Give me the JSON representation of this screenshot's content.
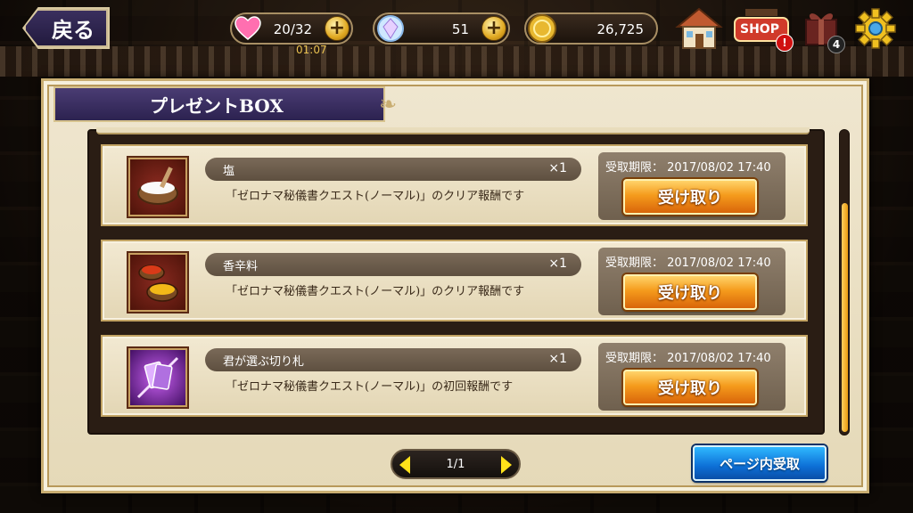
{
  "header": {
    "back_label": "戻る",
    "stamina": {
      "value": "20/32",
      "timer": "01:07",
      "icon": "heart-icon"
    },
    "gems": {
      "value": "51",
      "icon": "crystal-icon"
    },
    "coins": {
      "value": "26,725",
      "icon": "coin-icon"
    },
    "shop_label": "SHOP",
    "shop_badge": "!",
    "gift_badge": "4"
  },
  "panel": {
    "title": "プレゼントBOX"
  },
  "items": [
    {
      "name": "塩",
      "qty": "×1",
      "desc": "「ゼロナマ秘儀書クエスト(ノーマル)」のクリア報酬です",
      "deadline": "受取期限： 2017/08/02 17:40",
      "claim_label": "受け取り",
      "icon": "salt-bowl-icon"
    },
    {
      "name": "香辛料",
      "qty": "×1",
      "desc": "「ゼロナマ秘儀書クエスト(ノーマル)」のクリア報酬です",
      "deadline": "受取期限： 2017/08/02 17:40",
      "claim_label": "受け取り",
      "icon": "spice-bowls-icon"
    },
    {
      "name": "君が選ぶ切り札",
      "qty": "×1",
      "desc": "「ゼロナマ秘儀書クエスト(ノーマル)」の初回報酬です",
      "deadline": "受取期限： 2017/08/02 17:40",
      "claim_label": "受け取り",
      "icon": "cards-icon"
    }
  ],
  "pager": {
    "label": "1/1"
  },
  "page_claim_label": "ページ内受取",
  "colors": {
    "accent_orange": "#f59b1c",
    "accent_blue": "#0d6fd6",
    "title_purple": "#3a2d62"
  }
}
